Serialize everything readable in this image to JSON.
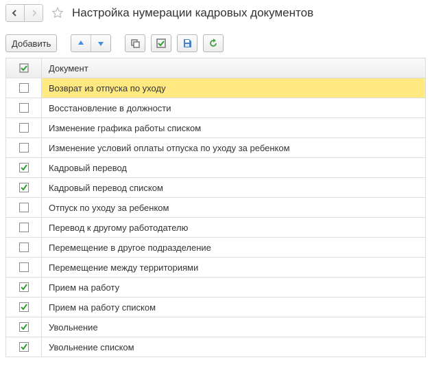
{
  "header": {
    "title": "Настройка нумерации кадровых документов"
  },
  "toolbar": {
    "add_label": "Добавить"
  },
  "table": {
    "header": {
      "document_label": "Документ"
    },
    "rows": [
      {
        "checked": false,
        "selected": true,
        "name": "Возврат из отпуска по уходу"
      },
      {
        "checked": false,
        "selected": false,
        "name": "Восстановление в должности"
      },
      {
        "checked": false,
        "selected": false,
        "name": "Изменение графика работы списком"
      },
      {
        "checked": false,
        "selected": false,
        "name": "Изменение условий оплаты отпуска по уходу за ребенком"
      },
      {
        "checked": true,
        "selected": false,
        "name": "Кадровый перевод"
      },
      {
        "checked": true,
        "selected": false,
        "name": "Кадровый перевод списком"
      },
      {
        "checked": false,
        "selected": false,
        "name": "Отпуск по уходу за ребенком"
      },
      {
        "checked": false,
        "selected": false,
        "name": "Перевод к другому работодателю"
      },
      {
        "checked": false,
        "selected": false,
        "name": "Перемещение в другое подразделение"
      },
      {
        "checked": false,
        "selected": false,
        "name": "Перемещение между территориями"
      },
      {
        "checked": true,
        "selected": false,
        "name": "Прием на работу"
      },
      {
        "checked": true,
        "selected": false,
        "name": "Прием на работу списком"
      },
      {
        "checked": true,
        "selected": false,
        "name": "Увольнение"
      },
      {
        "checked": true,
        "selected": false,
        "name": "Увольнение списком"
      }
    ]
  }
}
